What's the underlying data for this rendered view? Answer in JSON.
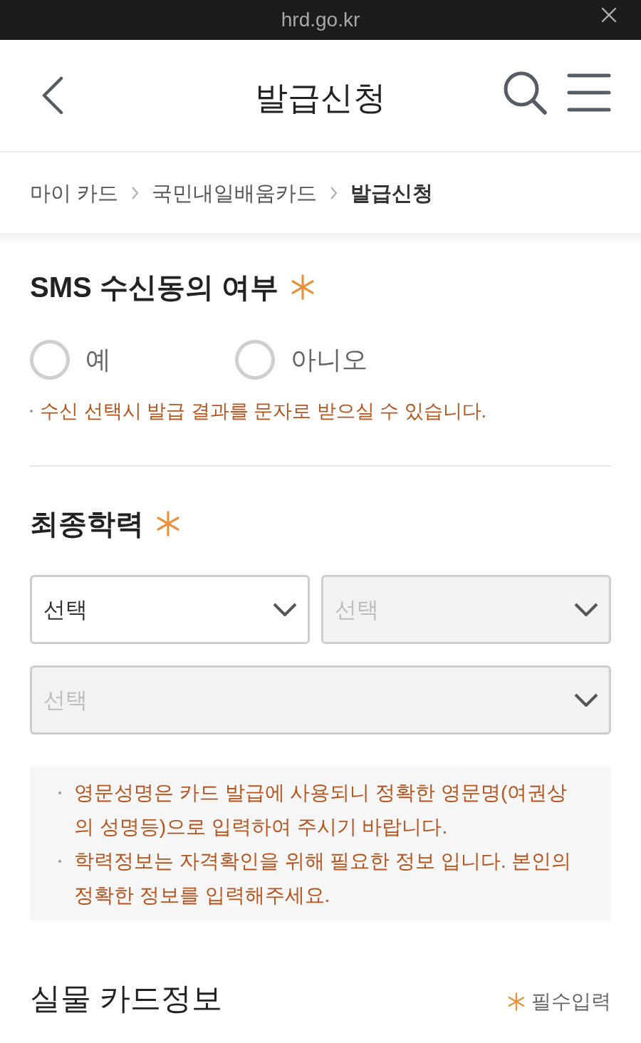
{
  "browser_bar": {
    "url": "hrd.go.kr"
  },
  "header": {
    "title": "발급신청"
  },
  "breadcrumb": [
    {
      "label": "마이 카드",
      "current": false
    },
    {
      "label": "국민내일배움카드",
      "current": false
    },
    {
      "label": "발급신청",
      "current": true
    }
  ],
  "sms_section": {
    "title": "SMS 수신동의 여부",
    "required": true,
    "options": [
      {
        "label": "예",
        "selected": false
      },
      {
        "label": "아니오",
        "selected": false
      }
    ],
    "note": "수신 선택시 발급 결과를 문자로 받으실 수 있습니다."
  },
  "education_section": {
    "title": "최종학력",
    "required": true,
    "selects": [
      {
        "placeholder": "선택",
        "disabled": false
      },
      {
        "placeholder": "선택",
        "disabled": true
      },
      {
        "placeholder": "선택",
        "disabled": true
      }
    ]
  },
  "notices": [
    "영문성명은 카드 발급에 사용되니 정확한 영문명(여권상의 성명등)으로 입력하여 주시기 바랍니다.",
    "학력정보는 자격확인을 위해 필요한 정보 입니다. 본인의 정확한 정보를 입력해주세요."
  ],
  "card_info_section": {
    "title": "실물 카드정보",
    "required_legend": "필수입력"
  }
}
